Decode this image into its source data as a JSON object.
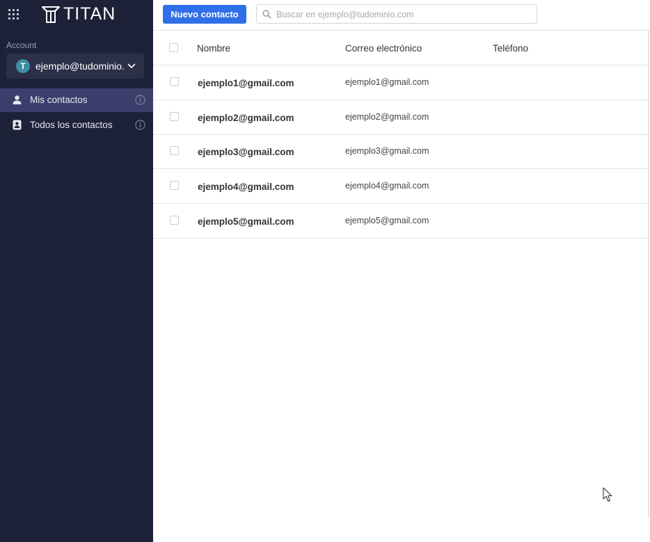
{
  "brand": {
    "name": "TITAN"
  },
  "sidebar": {
    "account_label": "Account",
    "account": {
      "initial": "T",
      "email": "ejemplo@tudominio...."
    },
    "items": [
      {
        "label": "Mis contactos",
        "icon": "person-icon",
        "active": true
      },
      {
        "label": "Todos los contactos",
        "icon": "contact-book-icon",
        "active": false
      }
    ]
  },
  "toolbar": {
    "new_contact_label": "Nuevo contacto",
    "search_placeholder": "Buscar en ejemplo@tudominio.com",
    "search_value": ""
  },
  "table": {
    "columns": [
      "Nombre",
      "Correo electrónico",
      "Teléfono"
    ],
    "rows": [
      {
        "name": "ejemplo1@gmail.com",
        "email": "ejemplo1@gmail.com",
        "phone": ""
      },
      {
        "name": "ejemplo2@gmail.com",
        "email": "ejemplo2@gmail.com",
        "phone": ""
      },
      {
        "name": "ejemplo3@gmail.com",
        "email": "ejemplo3@gmail.com",
        "phone": ""
      },
      {
        "name": "ejemplo4@gmail.com",
        "email": "ejemplo4@gmail.com",
        "phone": ""
      },
      {
        "name": "ejemplo5@gmail.com",
        "email": "ejemplo5@gmail.com",
        "phone": ""
      }
    ]
  },
  "colors": {
    "sidebar_bg": "#1e2238",
    "sidebar_active": "#3c3f6b",
    "accent": "#2f6fe8",
    "avatar": "#3d8ea3"
  }
}
